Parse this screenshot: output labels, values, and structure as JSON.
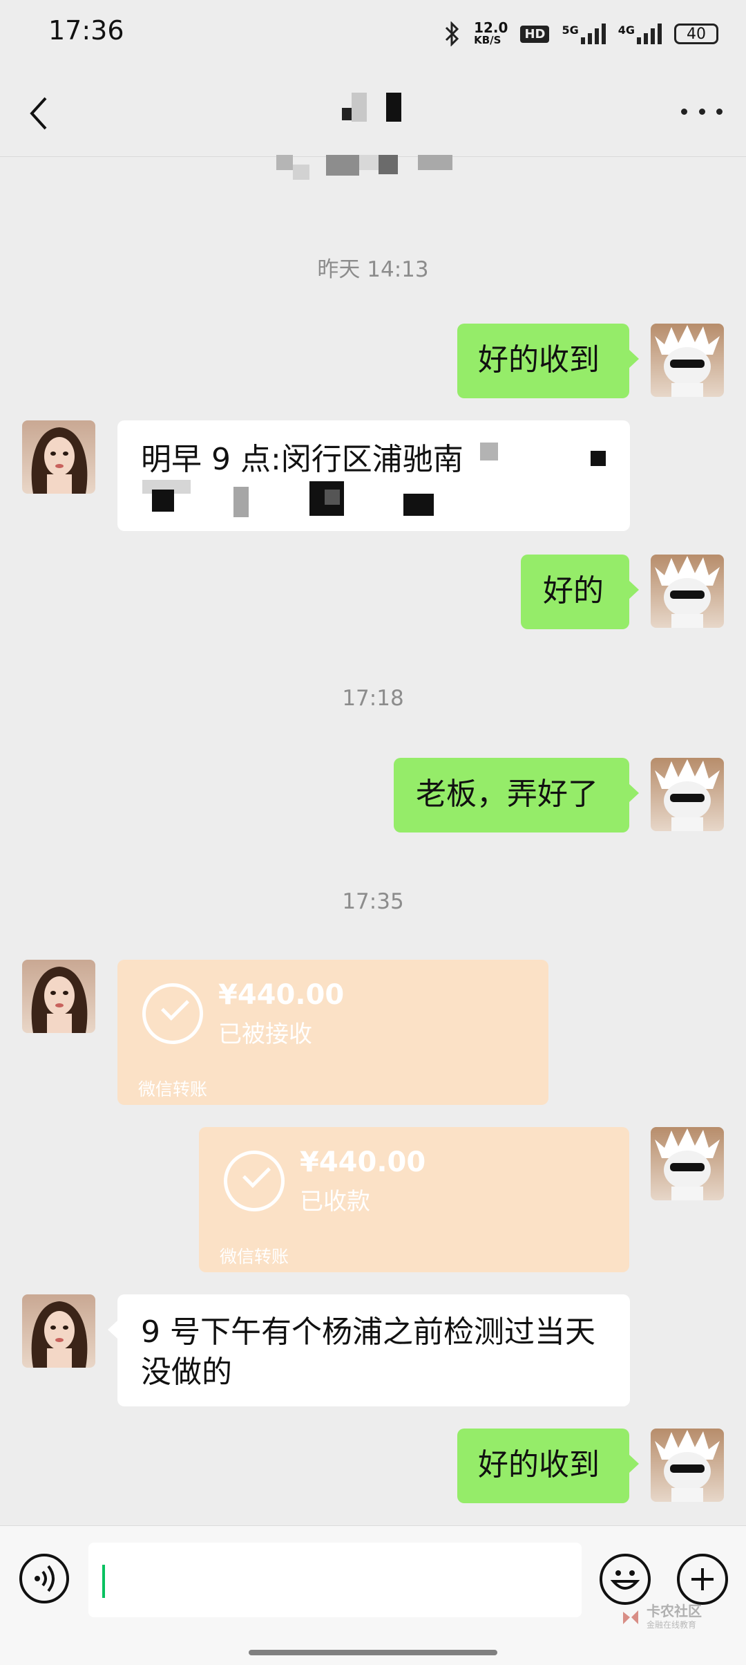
{
  "status_bar": {
    "time": "17:36",
    "net_speed_top": "12.0",
    "net_speed_bottom": "KB/S",
    "hd_label": "HD",
    "net1": "5G",
    "net2": "4G",
    "battery": "40"
  },
  "header": {
    "title": "",
    "back_icon": "chevron-left-icon",
    "more_icon": "more-dots-icon"
  },
  "messages": [
    {
      "type": "time",
      "text": "昨天 14:13"
    },
    {
      "type": "out",
      "text": "好的收到"
    },
    {
      "type": "in",
      "text_line1": "明早 9 点:闵行区浦驰南",
      "text_line2": ""
    },
    {
      "type": "out",
      "text": "好的"
    },
    {
      "type": "time",
      "text": "17:18"
    },
    {
      "type": "out",
      "text": "老板，弄好了"
    },
    {
      "type": "time",
      "text": "17:35"
    },
    {
      "type": "transfer_in",
      "amount": "¥440.00",
      "status": "已被接收",
      "footer": "微信转账"
    },
    {
      "type": "transfer_out",
      "amount": "¥440.00",
      "status": "已收款",
      "footer": "微信转账"
    },
    {
      "type": "in",
      "text_line1": "9 号下午有个杨浦之前检测过当天",
      "text_line2": "没做的"
    },
    {
      "type": "out",
      "text": "好的收到"
    }
  ],
  "input_bar": {
    "voice_icon": "voice-icon",
    "emoji_icon": "emoji-icon",
    "plus_icon": "plus-icon"
  },
  "watermark": {
    "line1": "卡农社区",
    "line2": "金融在线教育"
  },
  "colors": {
    "bg": "#ededed",
    "outgoing": "#95ec69",
    "incoming": "#ffffff",
    "transfer": "#fbe1c6",
    "accent": "#07c160"
  }
}
